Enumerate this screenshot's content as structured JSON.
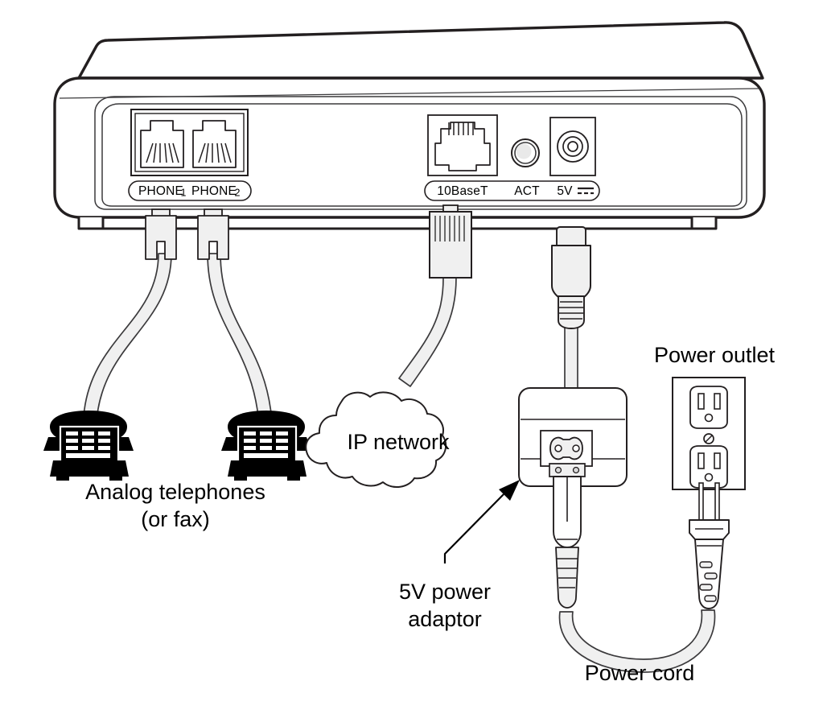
{
  "diagram": {
    "title": "VoIP gateway rear panel connection diagram",
    "device": {
      "name": "voip-gateway",
      "port_groups": [
        {
          "name": "phone-ports",
          "label_pill": "PHONE 1   PHONE 2",
          "ports": [
            {
              "label": "PHONE 1",
              "label_main": "PHONE",
              "label_num": "1",
              "type": "rj11"
            },
            {
              "label": "PHONE 2",
              "label_main": "PHONE",
              "label_num": "2",
              "type": "rj11"
            }
          ]
        },
        {
          "name": "network-power-ports",
          "ports": [
            {
              "label": "10BaseT",
              "type": "rj45"
            },
            {
              "label": "ACT",
              "type": "led"
            },
            {
              "label": "5V",
              "symbol": "dc",
              "type": "dc-jack"
            }
          ]
        }
      ]
    },
    "labels": {
      "analog_phones_line1": "Analog telephones",
      "analog_phones_line2": "(or fax)",
      "ip_network": "IP network",
      "power_adaptor_line1": "5V power",
      "power_adaptor_line2": "adaptor",
      "power_outlet": "Power outlet",
      "power_cord": "Power cord"
    },
    "colors": {
      "outline": "#231f20",
      "outline_soft": "#3b3a3c",
      "cable_fill": "#f0f0f0",
      "body_fill": "#ffffff",
      "icon_fill": "#000000",
      "background": "#ffffff"
    }
  }
}
